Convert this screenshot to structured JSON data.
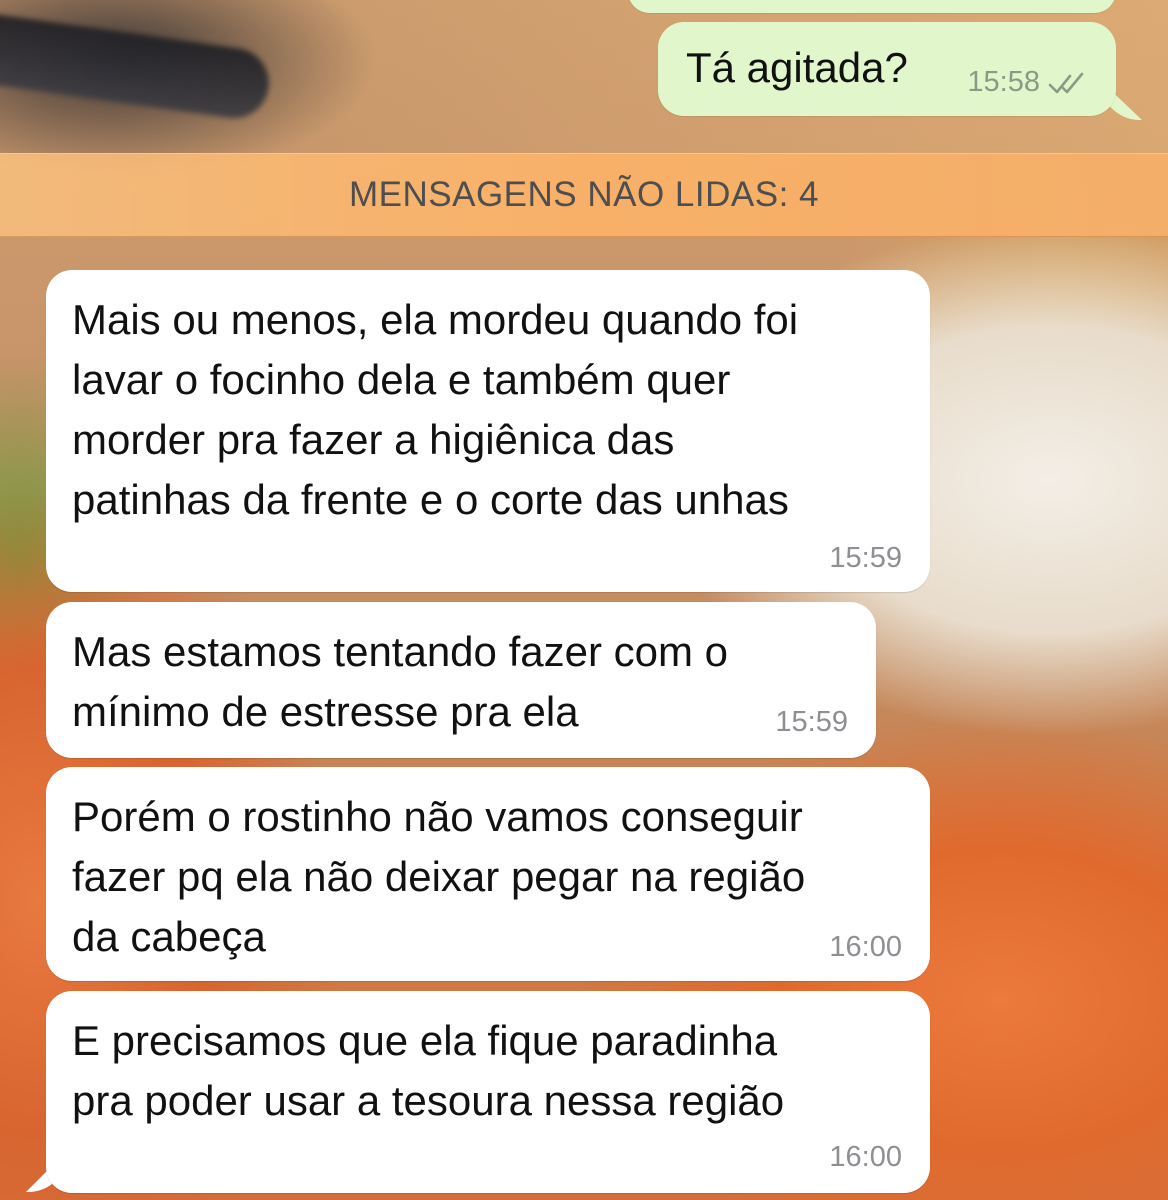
{
  "outgoing": [
    {
      "text": "",
      "time": ""
    },
    {
      "text": "Tá agitada?",
      "time": "15:58",
      "status_icon": "double-check-icon"
    }
  ],
  "unread_banner": {
    "label": "MENSAGENS NÃO LIDAS: 4"
  },
  "incoming": [
    {
      "lines": [
        "Mais ou menos, ela mordeu quando foi",
        "lavar o focinho dela e também quer",
        "morder pra fazer a higiênica das",
        "patinhas da frente e o corte das unhas"
      ],
      "time": "15:59"
    },
    {
      "lines": [
        "Mas estamos tentando fazer com o",
        "mínimo de estresse pra ela"
      ],
      "time": "15:59"
    },
    {
      "lines": [
        "Porém o rostinho não vamos conseguir",
        "fazer pq ela não deixar pegar na região",
        "da cabeça"
      ],
      "time": "16:00"
    },
    {
      "lines": [
        "E precisamos que ela fique paradinha",
        "pra poder usar a tesoura nessa região"
      ],
      "time": "16:00"
    }
  ],
  "colors": {
    "outgoing_bubble": "#e1f7cb",
    "incoming_bubble": "#ffffff",
    "unread_banner": "#fbb268",
    "read_check": "#8a9a86"
  }
}
